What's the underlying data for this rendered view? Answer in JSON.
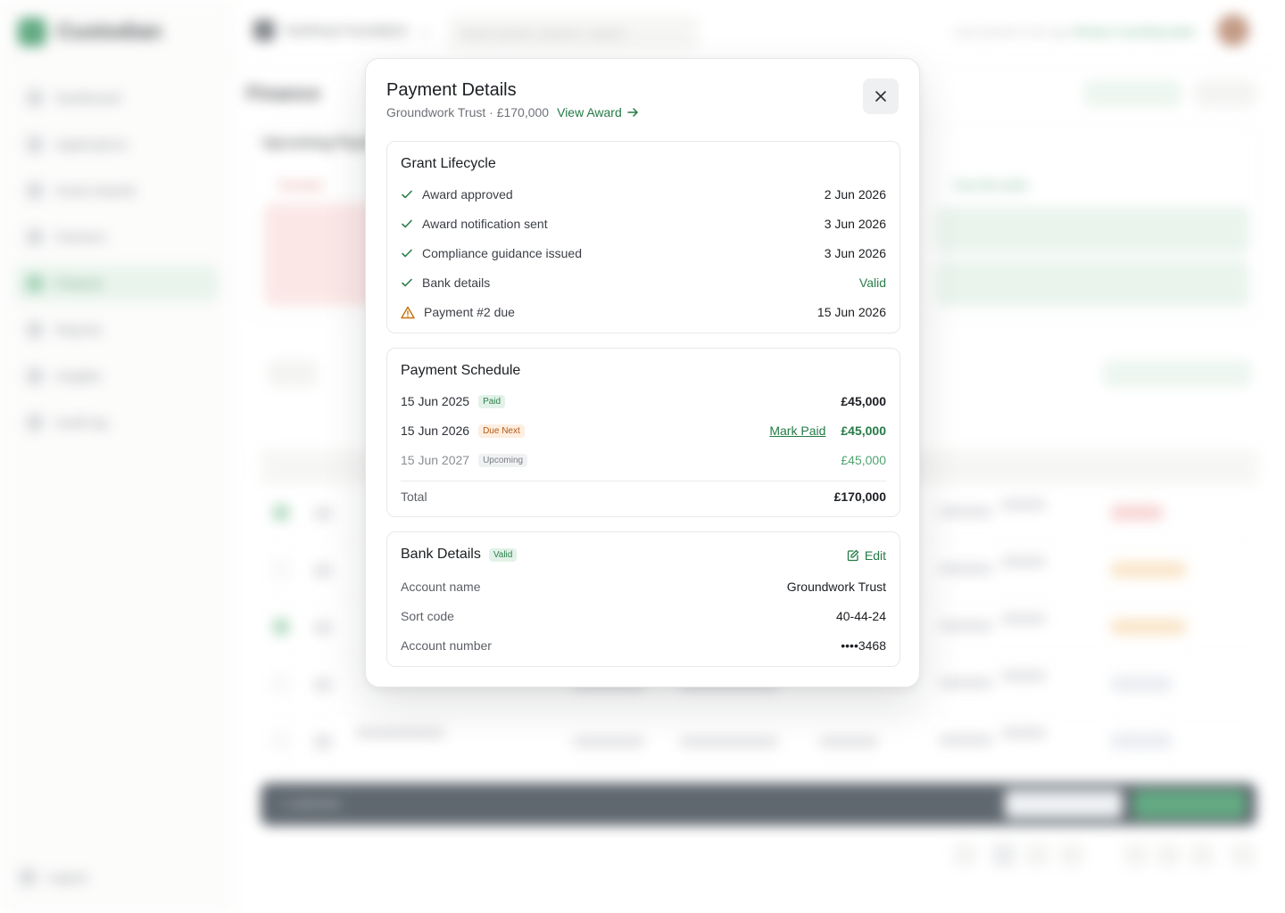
{
  "app": {
    "name": "Custodian",
    "workspace": "Northrop Foundation",
    "search_placeholder": "Search grants, partners, reports",
    "top_status": "Last synced 2 min ago",
    "top_link": "Review 4 pending tasks",
    "nav": [
      "Dashboard",
      "Applications",
      "Grant Awards",
      "Partners",
      "Finance",
      "Reports",
      "Insights",
      "Audit log"
    ],
    "logout": "Logout",
    "page_title": "Finance",
    "upcoming_label": "Upcoming Payments",
    "overdue_label": "Overdue",
    "due_soon_label": "Due this week",
    "bulk_label": "1 selected"
  },
  "modal": {
    "title": "Payment Details",
    "subtitle": "Groundwork Trust · £170,000",
    "view_award": "View Award",
    "lifecycle": {
      "title": "Grant Lifecycle",
      "items": [
        {
          "label": "Award approved",
          "value": "2 Jun 2026",
          "status": "done"
        },
        {
          "label": "Award notification sent",
          "value": "3 Jun 2026",
          "status": "done"
        },
        {
          "label": "Compliance guidance issued",
          "value": "3 Jun 2026",
          "status": "done"
        },
        {
          "label": "Bank details",
          "value": "Valid",
          "status": "done"
        },
        {
          "label": "Payment #2 due",
          "value": "15 Jun 2026",
          "status": "warning"
        }
      ]
    },
    "schedule": {
      "title": "Payment Schedule",
      "payments": [
        {
          "date": "15 Jun 2025",
          "badge": "Paid",
          "amount": "£45,000"
        },
        {
          "date": "15 Jun 2026",
          "badge": "Due Next",
          "action": "Mark Paid",
          "amount": "£45,000"
        },
        {
          "date": "15 Jun 2027",
          "badge": "Upcoming",
          "amount": "£45,000"
        }
      ],
      "total_label": "Total",
      "total_value": "£170,000"
    },
    "bank": {
      "title": "Bank Details",
      "badge": "Valid",
      "edit": "Edit",
      "fields": [
        {
          "label": "Account name",
          "value": "Groundwork Trust"
        },
        {
          "label": "Sort code",
          "value": "40-44-24"
        },
        {
          "label": "Account number",
          "value": "••••3468"
        }
      ]
    }
  },
  "colors": {
    "accent": "#237a45",
    "warning": "#c2710c"
  }
}
